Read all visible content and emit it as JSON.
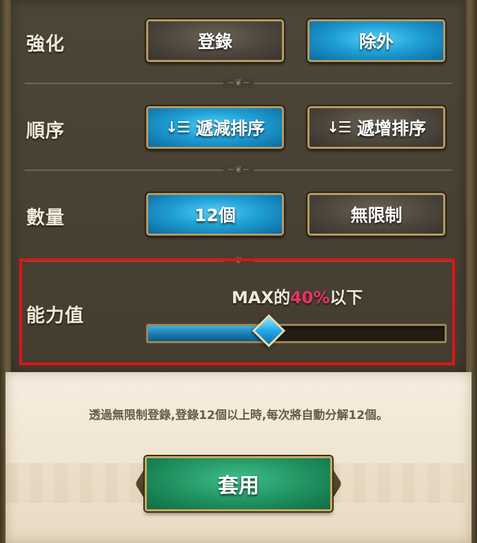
{
  "filters": {
    "enhance": {
      "label": "強化",
      "options": [
        "登錄",
        "除外"
      ],
      "selected": "除外"
    },
    "order": {
      "label": "順序",
      "options": [
        "遞減排序",
        "遞增排序"
      ],
      "selected": "遞減排序"
    },
    "quantity": {
      "label": "數量",
      "options": [
        "12個",
        "無限制"
      ],
      "selected": "12個"
    },
    "ability": {
      "label": "能力值",
      "text_prefix": "MAX的",
      "percent_text": "40%",
      "text_suffix": "以下",
      "slider_fraction": 0.4
    }
  },
  "info_text": "透過無限制登錄,登錄12個以上時,每次將自動分解12個。",
  "apply_label": "套用",
  "colors": {
    "accent": "#1fa0d6",
    "percent": "#e8336a",
    "apply": "#229563",
    "highlight": "#e0131a"
  },
  "icons": {
    "sort_desc": "sort-descending-icon",
    "sort_asc": "sort-ascending-icon"
  }
}
